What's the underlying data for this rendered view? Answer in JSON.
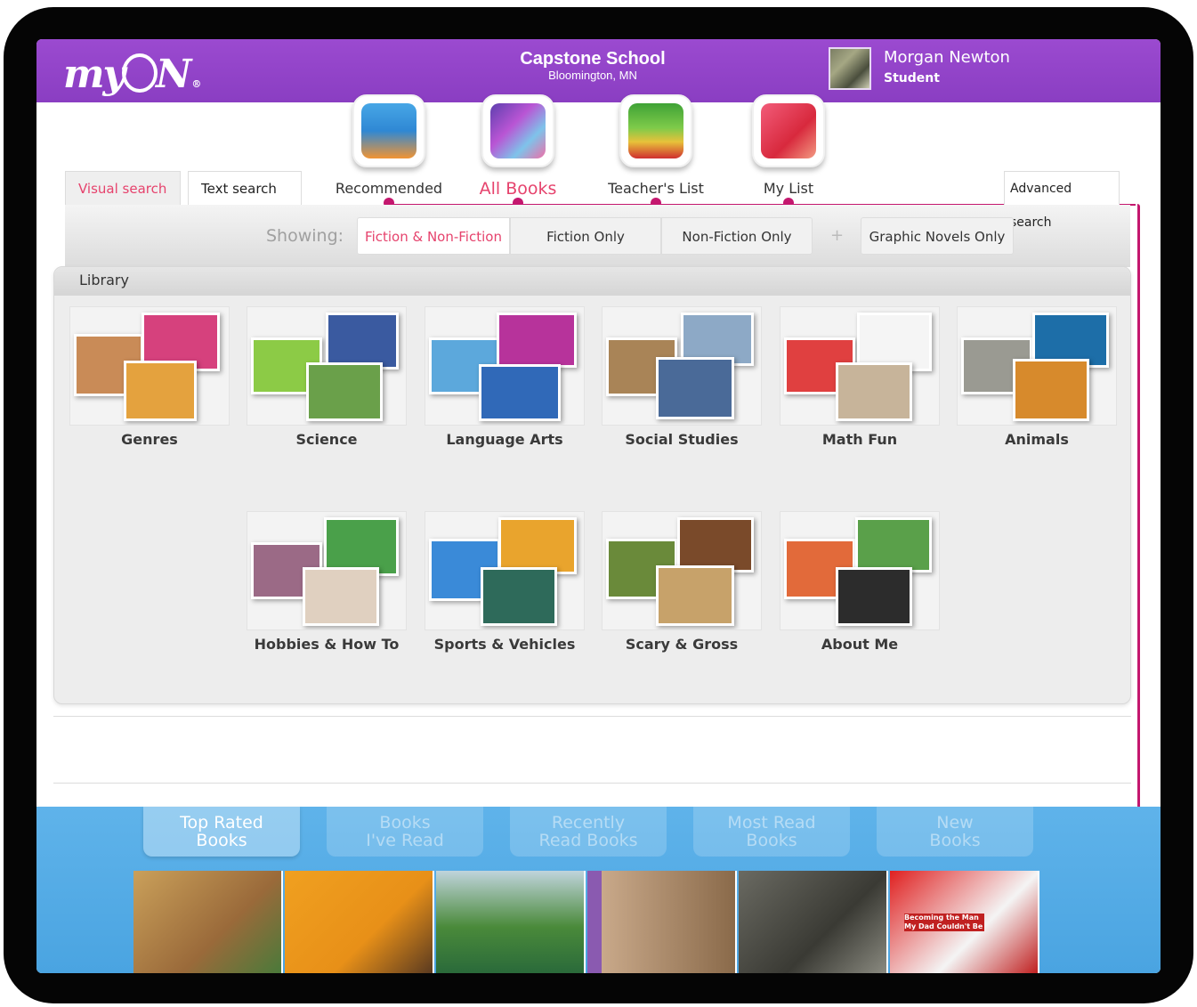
{
  "header": {
    "logo": "myON",
    "school_name": "Capstone School",
    "school_location": "Bloomington, MN",
    "user_name": "Morgan Newton",
    "user_role": "Student"
  },
  "categories": [
    {
      "label": "Recommended",
      "icon": "recommended-icon"
    },
    {
      "label": "All Books",
      "icon": "all-books-icon",
      "active": true
    },
    {
      "label": "Teacher's List",
      "icon": "teachers-list-icon"
    },
    {
      "label": "My List",
      "icon": "my-list-icon"
    }
  ],
  "search_tabs": {
    "visual": "Visual search",
    "text": "Text search",
    "advanced": "Advanced search"
  },
  "filters": {
    "showing_label": "Showing:",
    "options": [
      "Fiction & Non-Fiction",
      "Fiction Only",
      "Non-Fiction Only",
      "Graphic Novels Only"
    ],
    "selected": "Fiction & Non-Fiction",
    "plus": "+"
  },
  "library": {
    "title": "Library",
    "items": [
      {
        "label": "Genres"
      },
      {
        "label": "Science"
      },
      {
        "label": "Language Arts"
      },
      {
        "label": "Social Studies"
      },
      {
        "label": "Math Fun"
      },
      {
        "label": "Animals"
      },
      {
        "label": "Hobbies & How To"
      },
      {
        "label": "Sports & Vehicles"
      },
      {
        "label": "Scary & Gross"
      },
      {
        "label": "About Me"
      }
    ]
  },
  "shelf": {
    "tabs": [
      {
        "line1": "Top Rated",
        "line2": "Books",
        "active": true
      },
      {
        "line1": "Books",
        "line2": "I've Read"
      },
      {
        "line1": "Recently",
        "line2": "Read Books"
      },
      {
        "line1": "Most Read",
        "line2": "Books"
      },
      {
        "line1": "New",
        "line2": "Books"
      }
    ],
    "cover_text": "Becoming the Man My Dad Couldn't Be"
  },
  "colors": {
    "header_purple": "#9b4ad0",
    "accent_pink": "#e6436d",
    "connector_magenta": "#c4176e",
    "shelf_blue": "#5fb3ea"
  }
}
